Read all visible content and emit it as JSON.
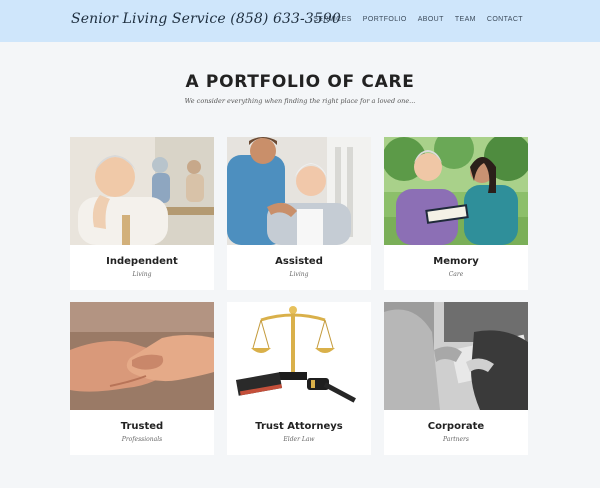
{
  "header": {
    "brand": "Senior Living Service (858) 633-3590",
    "menu": [
      "SERVICES",
      "PORTFOLIO",
      "ABOUT",
      "TEAM",
      "CONTACT"
    ]
  },
  "section": {
    "title": "A PORTFOLIO OF CARE",
    "subtitle": "We consider everything when finding the right place for a loved one..."
  },
  "cards": [
    {
      "title": "Independent",
      "subtitle": "Living"
    },
    {
      "title": "Assisted",
      "subtitle": "Living"
    },
    {
      "title": "Memory",
      "subtitle": "Care"
    },
    {
      "title": "Trusted",
      "subtitle": "Professionals"
    },
    {
      "title": "Trust Attorneys",
      "subtitle": "Elder Law"
    },
    {
      "title": "Corporate",
      "subtitle": "Partners"
    }
  ],
  "colors": {
    "nav_bg": "#cfe6fb",
    "page_bg": "#f4f6f8"
  }
}
